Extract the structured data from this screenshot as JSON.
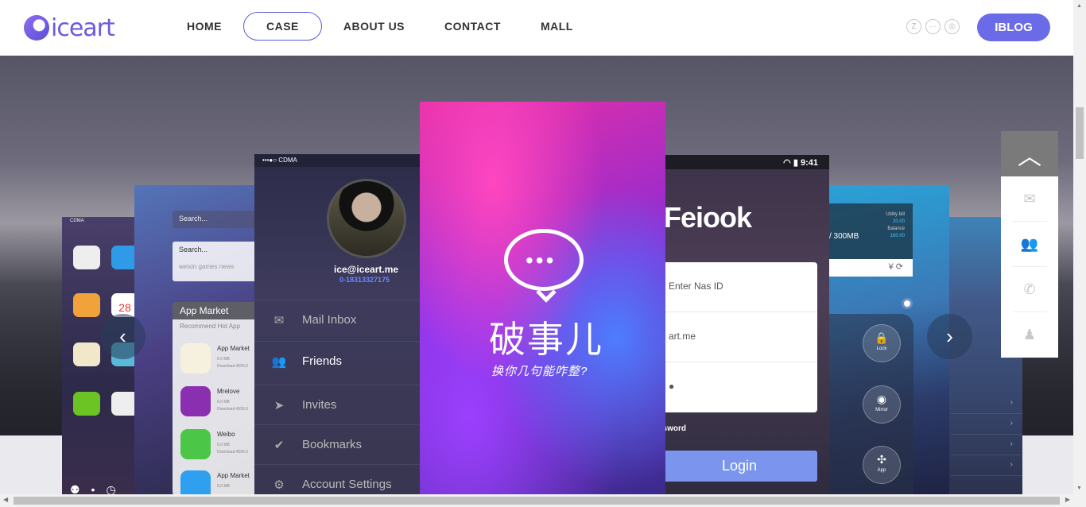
{
  "brand": {
    "name": "iceart"
  },
  "nav": {
    "items": [
      "HOME",
      "CASE",
      "ABOUT US",
      "CONTACT",
      "MALL"
    ],
    "active": "CASE"
  },
  "header": {
    "social_icons": [
      "zhihu-icon",
      "chat-icon",
      "weibo-icon"
    ],
    "blog_button": "IBLOG"
  },
  "colors": {
    "accent": "#6b6be8",
    "nav_border": "#5a5bd6"
  },
  "phones": {
    "p1": {
      "status": "CDMA",
      "date": "28"
    },
    "p2": {
      "search1": "Search...",
      "search2": "Search...",
      "search_tags": "weixin   games   news",
      "market_title": "App Market",
      "market_tabs": "Recommend      Hot App",
      "apps": [
        {
          "name": "App Market",
          "size": "6.0 MB",
          "downloads": "Download:4590.0"
        },
        {
          "name": "Mrelove",
          "size": "6.0 MB",
          "downloads": "Download:4590.0"
        },
        {
          "name": "Weibo",
          "size": "6.0 MB",
          "downloads": "Download:4590.0"
        },
        {
          "name": "App Market",
          "size": "6.0 MB",
          "downloads": "Download:4590.0"
        }
      ]
    },
    "p3": {
      "status": "CDMA",
      "email": "ice@iceart.me",
      "phone": "0-18313327175",
      "menu": [
        {
          "icon": "✉",
          "label": "Mail Inbox"
        },
        {
          "icon": "👥",
          "label": "Friends"
        },
        {
          "icon": "➤",
          "label": "Invites"
        },
        {
          "icon": "✔",
          "label": "Bookmarks"
        },
        {
          "icon": "⚙",
          "label": "Account Settings"
        }
      ]
    },
    "p4": {
      "title": "破事儿",
      "subtitle": "换你几句能咋整?"
    },
    "p5": {
      "time": "9:41",
      "brand": "Feiook",
      "fields": [
        "Enter Nas ID",
        "art.me",
        "●"
      ],
      "forgot": "ssword",
      "login": "Login"
    },
    "p6": {
      "card_lines": [
        "Utility bill",
        "20.00",
        "Balance",
        "160.00"
      ],
      "card_main": "/ 300MB",
      "card_bar": "¥    ⟳",
      "controls": [
        "Lock",
        "Mirror",
        "App"
      ]
    }
  },
  "side_toolbar": {
    "icons": [
      "chevron-up-icon",
      "mail-icon",
      "contacts-icon",
      "phone-icon",
      "qq-icon"
    ]
  }
}
